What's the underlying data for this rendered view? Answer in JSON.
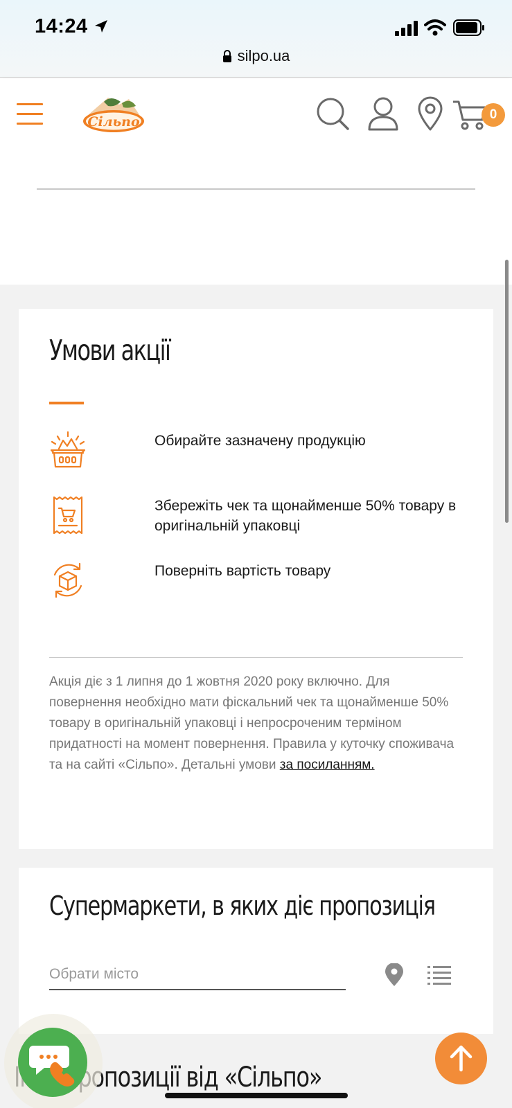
{
  "status_bar": {
    "time": "14:24",
    "url": "silpo.ua"
  },
  "header": {
    "logo_text": "Сільпо",
    "cart_count": "0"
  },
  "conditions": {
    "title": "Умови акції",
    "steps": [
      {
        "icon": "basket-icon",
        "text": "Обирайте зазначену продукцію"
      },
      {
        "icon": "receipt-cart-icon",
        "text": "Збережіть чек та щонайменше 50% товару в оригінальній упаковці"
      },
      {
        "icon": "box-return-icon",
        "text": "Поверніть вартість товару"
      }
    ],
    "terms_text": "Акція діє з 1 липня до 1 жовтня 2020 року включно. Для повернення необхідно мати фіскальний чек та щонайменше 50% товару в оригінальній упаковці і непросроченим терміном придатності на момент повернення. Правила у куточку споживача та на сайті «Сільпо». Детальні умови ",
    "terms_link": "за посиланням."
  },
  "supermarkets": {
    "title": "Супермаркети, в яких діє пропозиція",
    "city_placeholder": "Обрати місто"
  },
  "next_section_title": "Інші пропозиції від «Сільпо»",
  "colors": {
    "accent": "#f07f22",
    "badge": "#f39a3c",
    "chat": "#4caf50"
  }
}
